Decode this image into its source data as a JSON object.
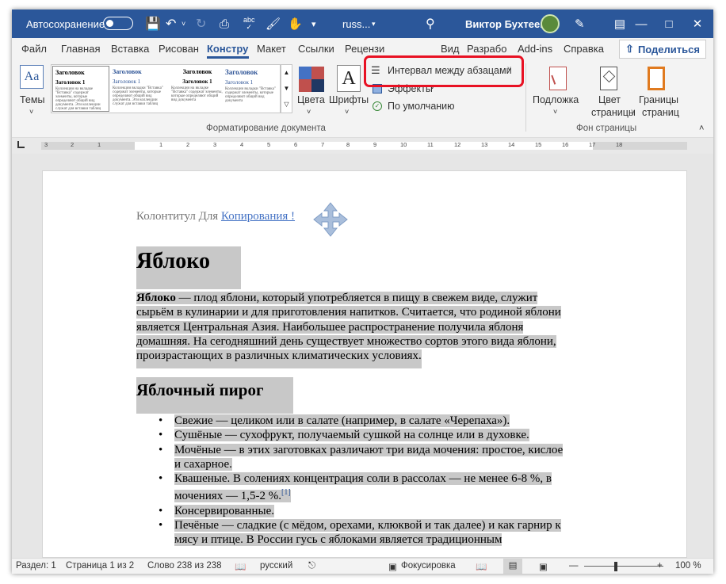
{
  "titlebar": {
    "autosave": "Автосохранение",
    "filename": "russ...",
    "user": "Виктор Бухтеев"
  },
  "tabs": [
    "Файл",
    "Главная",
    "Вставка",
    "Рисован",
    "Конструк",
    "Макет",
    "Ссылки",
    "Рецензи",
    "Вид",
    "Разрабо",
    "Add-ins",
    "Справка"
  ],
  "share": "Поделиться",
  "ribbon": {
    "themes": "Темы",
    "thumb_heading": "Заголовок",
    "thumb_heading1": "Заголовок 1",
    "colors": "Цвета",
    "fonts": "Шрифты",
    "spacing": "Интервал между абзацами",
    "effects": "Эффекты",
    "default": "По умолчанию",
    "group_format": "Форматирование документа",
    "watermark": "Подложка",
    "page_color_1": "Цвет",
    "page_color_2": "страницы",
    "borders_1": "Границы",
    "borders_2": "страниц",
    "group_bg": "Фон страницы"
  },
  "ruler": [
    "3",
    "2",
    "1",
    "1",
    "2",
    "3",
    "4",
    "5",
    "6",
    "7",
    "8",
    "9",
    "10",
    "11",
    "12",
    "13",
    "14",
    "15",
    "16",
    "17",
    "18"
  ],
  "doc": {
    "header_text": "Колонтитул Для ",
    "header_link": "Копирования !",
    "h1": "Яблоко",
    "p_bold": "Яблоко",
    "p_lines": [
      " — плод яблони, который употребляется в пищу в свежем виде, служит",
      "сырьём в кулинарии и для приготовления напитков. Считается, что родиной яблони",
      "является Центральная Азия. Наибольшее распространение получила яблоня",
      "домашняя. На сегодняшний день существует множество сортов этого вида яблони,",
      "произрастающих в различных климатических условиях."
    ],
    "h2": "Яблочный пирог",
    "items": [
      [
        "Свежие — целиком или в салате (например, в салате «Черепаха»)."
      ],
      [
        "Сушёные — сухофрукт, получаемый сушкой на солнце или в духовке."
      ],
      [
        "Мочёные — в этих заготовках различают три вида мочения: простое, кислое",
        "и сахарное."
      ],
      [
        "Квашеные. В солениях концентрация соли в рассолах — не менее 6-8 %, в",
        "мочениях — 1,5-2 %."
      ],
      [
        "Консервированные."
      ],
      [
        "Печёные — сладкие (с мёдом, орехами, клюквой и так далее) и как гарнир к",
        "мясу и птице. В России гусь с яблоками является традиционным"
      ]
    ],
    "footnote": "[1]"
  },
  "status": {
    "section": "Раздел: 1",
    "page": "Страница 1 из 2",
    "words": "Слово 238 из 238",
    "lang": "русский",
    "focus": "Фокусировка",
    "zoom": "100 %"
  }
}
